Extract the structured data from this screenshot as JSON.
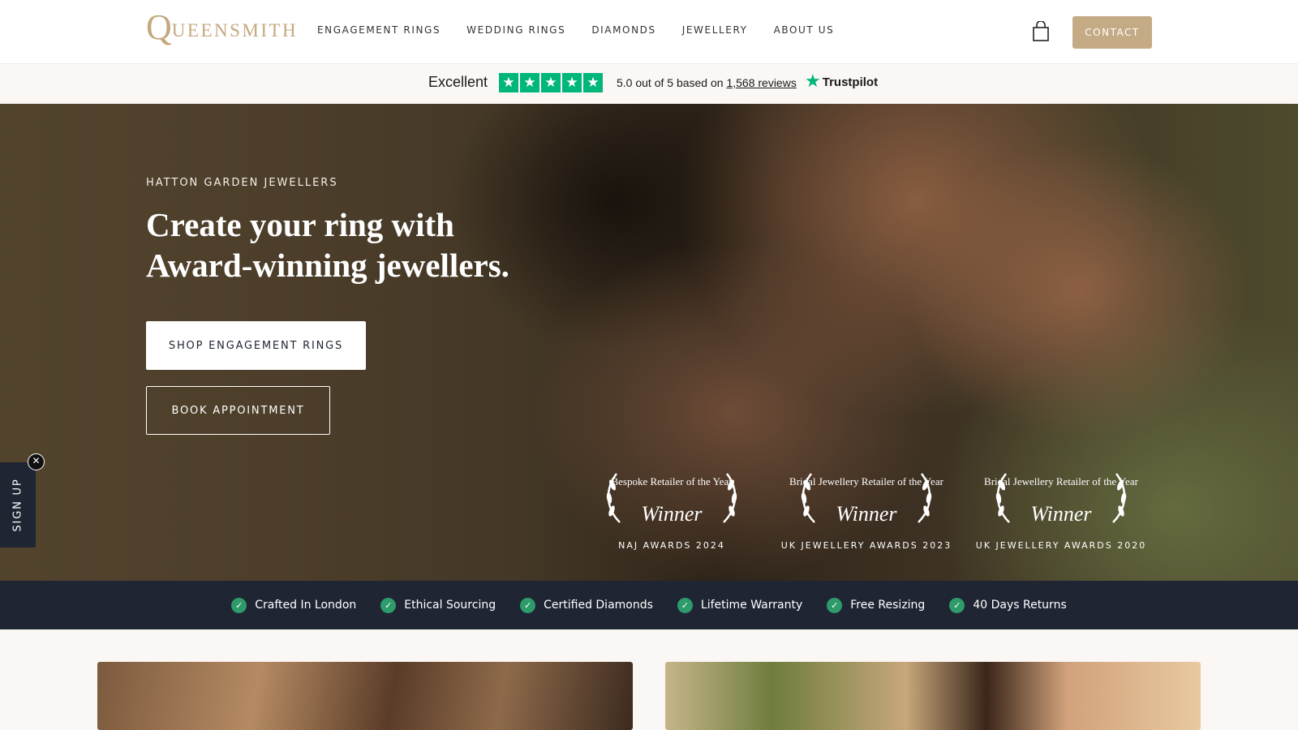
{
  "header": {
    "logo_initial": "Q",
    "logo_rest": "UEENSMITH",
    "nav": [
      "ENGAGEMENT RINGS",
      "WEDDING RINGS",
      "DIAMONDS",
      "JEWELLERY",
      "ABOUT US"
    ],
    "contact_label": "CONTACT",
    "cart_icon": "shopping-bag-icon"
  },
  "trustpilot": {
    "rating_word": "Excellent",
    "score_text": "5.0 out of 5 based on",
    "reviews_link": "1,568 reviews",
    "brand": "Trustpilot",
    "stars": 5,
    "star_color": "#00b67a"
  },
  "hero": {
    "kicker": "HATTON GARDEN JEWELLERS",
    "headline": "Create your ring with Award-winning jewellers.",
    "primary_cta": "SHOP ENGAGEMENT RINGS",
    "secondary_cta": "BOOK APPOINTMENT",
    "awards": [
      {
        "title": "Bespoke Retailer of the Year",
        "winner": "Winner",
        "org": "NAJ AWARDS 2024"
      },
      {
        "title": "Bridal Jewellery Retailer of the Year",
        "winner": "Winner",
        "org": "UK JEWELLERY AWARDS 2023"
      },
      {
        "title": "Bridal Jewellery Retailer of the Year",
        "winner": "Winner",
        "org": "UK JEWELLERY AWARDS 2020"
      }
    ]
  },
  "signup": {
    "label": "SIGN UP",
    "close_icon": "close-icon"
  },
  "usp": [
    "Crafted In London",
    "Ethical Sourcing",
    "Certified Diamonds",
    "Lifetime Warranty",
    "Free Resizing",
    "40 Days Returns"
  ],
  "colors": {
    "brand_gold": "#c4a87e",
    "navy": "#1f2533",
    "check_green": "#2e9b6a"
  }
}
